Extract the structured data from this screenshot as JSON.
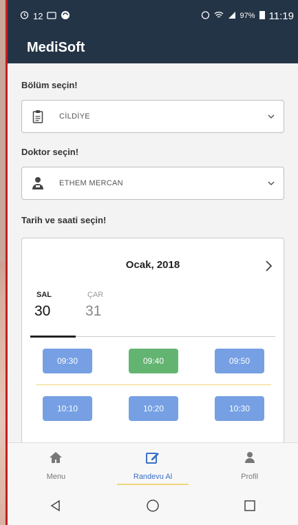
{
  "statusbar": {
    "left_time_small": "12",
    "battery_percent": "97%",
    "clock": "11:19"
  },
  "app": {
    "title": "MediSoft"
  },
  "form": {
    "department_label": "Bölüm seçin!",
    "department_value": "CİLDİYE",
    "doctor_label": "Doktor seçin!",
    "doctor_value": "ETHEM MERCAN",
    "datetime_label": "Tarih ve saati seçin!"
  },
  "calendar": {
    "month": "Ocak,  2018",
    "days": [
      {
        "name": "SAL",
        "date": "30"
      },
      {
        "name": "ÇAR",
        "date": "31"
      }
    ],
    "slots_row1": [
      "09:30",
      "09:40",
      "09:50"
    ],
    "slots_row2": [
      "10:10",
      "10:20",
      "10:30"
    ]
  },
  "bottom_nav": {
    "menu": "Menu",
    "appointment": "Randevu Al",
    "profile": "Profil"
  },
  "colors": {
    "appbar": "#243447",
    "slot": "#6f9be2",
    "slot_selected": "#5bb16a",
    "frame_red": "#c0201f"
  }
}
